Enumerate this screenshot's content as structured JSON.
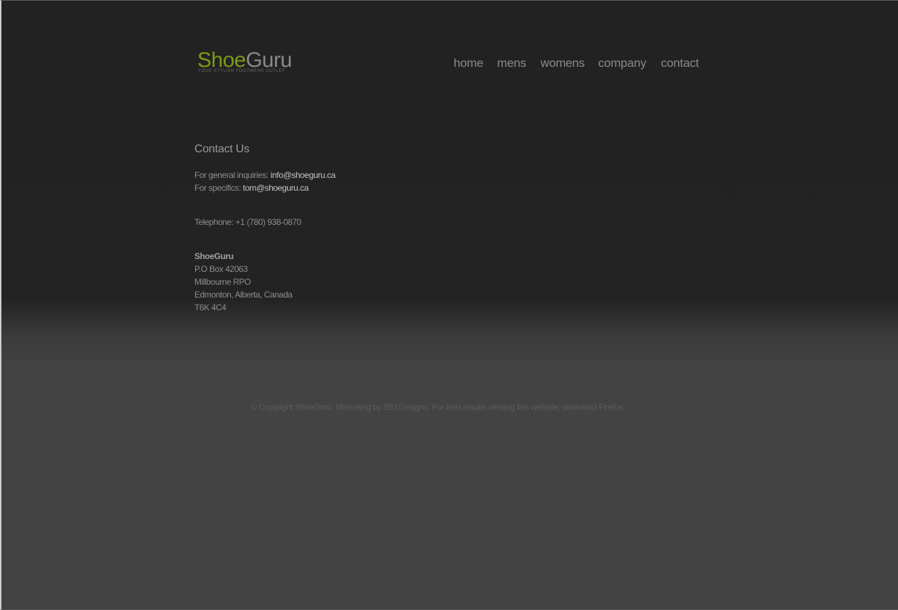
{
  "logo": {
    "shoe": "Shoe",
    "guru": "Guru",
    "tagline": "YOUR STYLISH FOOTWEAR OUTLET"
  },
  "nav": {
    "items": [
      {
        "label": "home"
      },
      {
        "label": "mens"
      },
      {
        "label": "womens"
      },
      {
        "label": "company"
      },
      {
        "label": "contact"
      }
    ]
  },
  "contact": {
    "heading": "Contact Us",
    "general_label": "For general inquiries:",
    "general_email": "info@shoeguru.ca",
    "specifics_label": "For specifics:",
    "specifics_email": "tom@shoeguru.ca",
    "telephone": "Telephone: +1 (780) 938-0870",
    "address": {
      "name": "ShoeGuru",
      "line1": "P.O Box 42063",
      "line2": "Millbourne RPO",
      "line3": "Edmonton, Alberta, Canada",
      "line4": "T6K 4C4"
    }
  },
  "footer": {
    "copyright": "© Copyright ShoeGuru.",
    "marketing_prefix": "Marketing by",
    "marketing_link": "350 Designs",
    "best_results": ". For best results viewing this website, download",
    "firefox_link": "Firefox",
    "end": "."
  },
  "colors": {
    "background_top": "#222222",
    "background_bottom": "#434343",
    "brand_green": "#7e9a12",
    "nav_text": "#8a8a8a"
  }
}
